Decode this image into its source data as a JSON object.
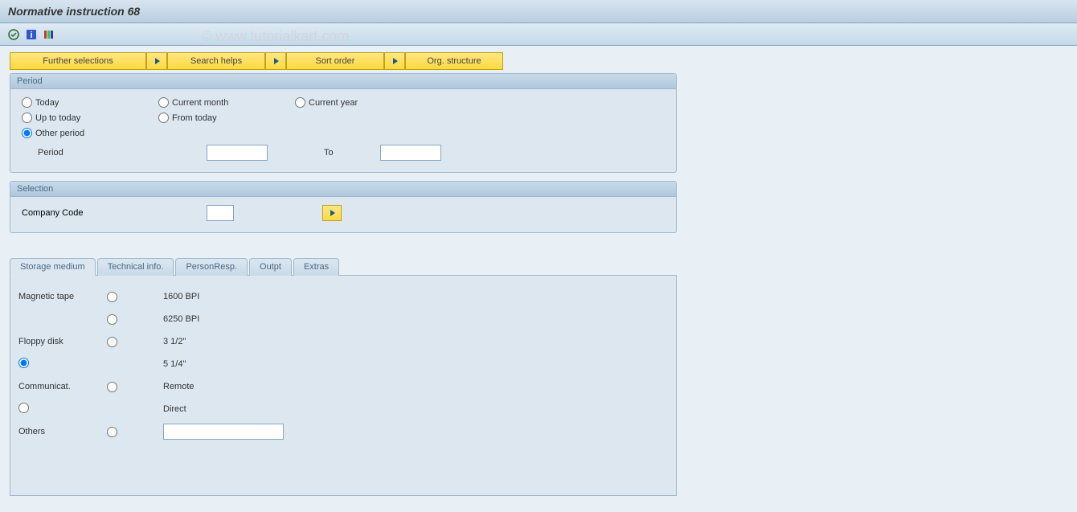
{
  "title": "Normative instruction 68",
  "watermark": "© www.tutorialkart.com",
  "buttons": {
    "further_selections": "Further selections",
    "search_helps": "Search helps",
    "sort_order": "Sort order",
    "org_structure": "Org. structure"
  },
  "period": {
    "title": "Period",
    "today": "Today",
    "current_month": "Current month",
    "current_year": "Current year",
    "up_to_today": "Up to today",
    "from_today": "From today",
    "other_period": "Other period",
    "period_label": "Period",
    "to_label": "To",
    "period_from": "",
    "period_to": ""
  },
  "selection": {
    "title": "Selection",
    "company_code_label": "Company Code",
    "company_code_value": ""
  },
  "tabs": {
    "storage": "Storage medium",
    "technical": "Technical info.",
    "person": "PersonResp.",
    "output": "Outpt",
    "extras": "Extras"
  },
  "storage": {
    "magnetic_tape": "Magnetic tape",
    "bpi_1600": "1600 BPI",
    "bpi_6250": "6250 BPI",
    "floppy_disk": "Floppy disk",
    "size_3_5": "3  1/2\"",
    "size_5_25": "5  1/4\"",
    "communicat": "Communicat.",
    "remote": "Remote",
    "direct": "Direct",
    "others": "Others",
    "others_value": ""
  }
}
